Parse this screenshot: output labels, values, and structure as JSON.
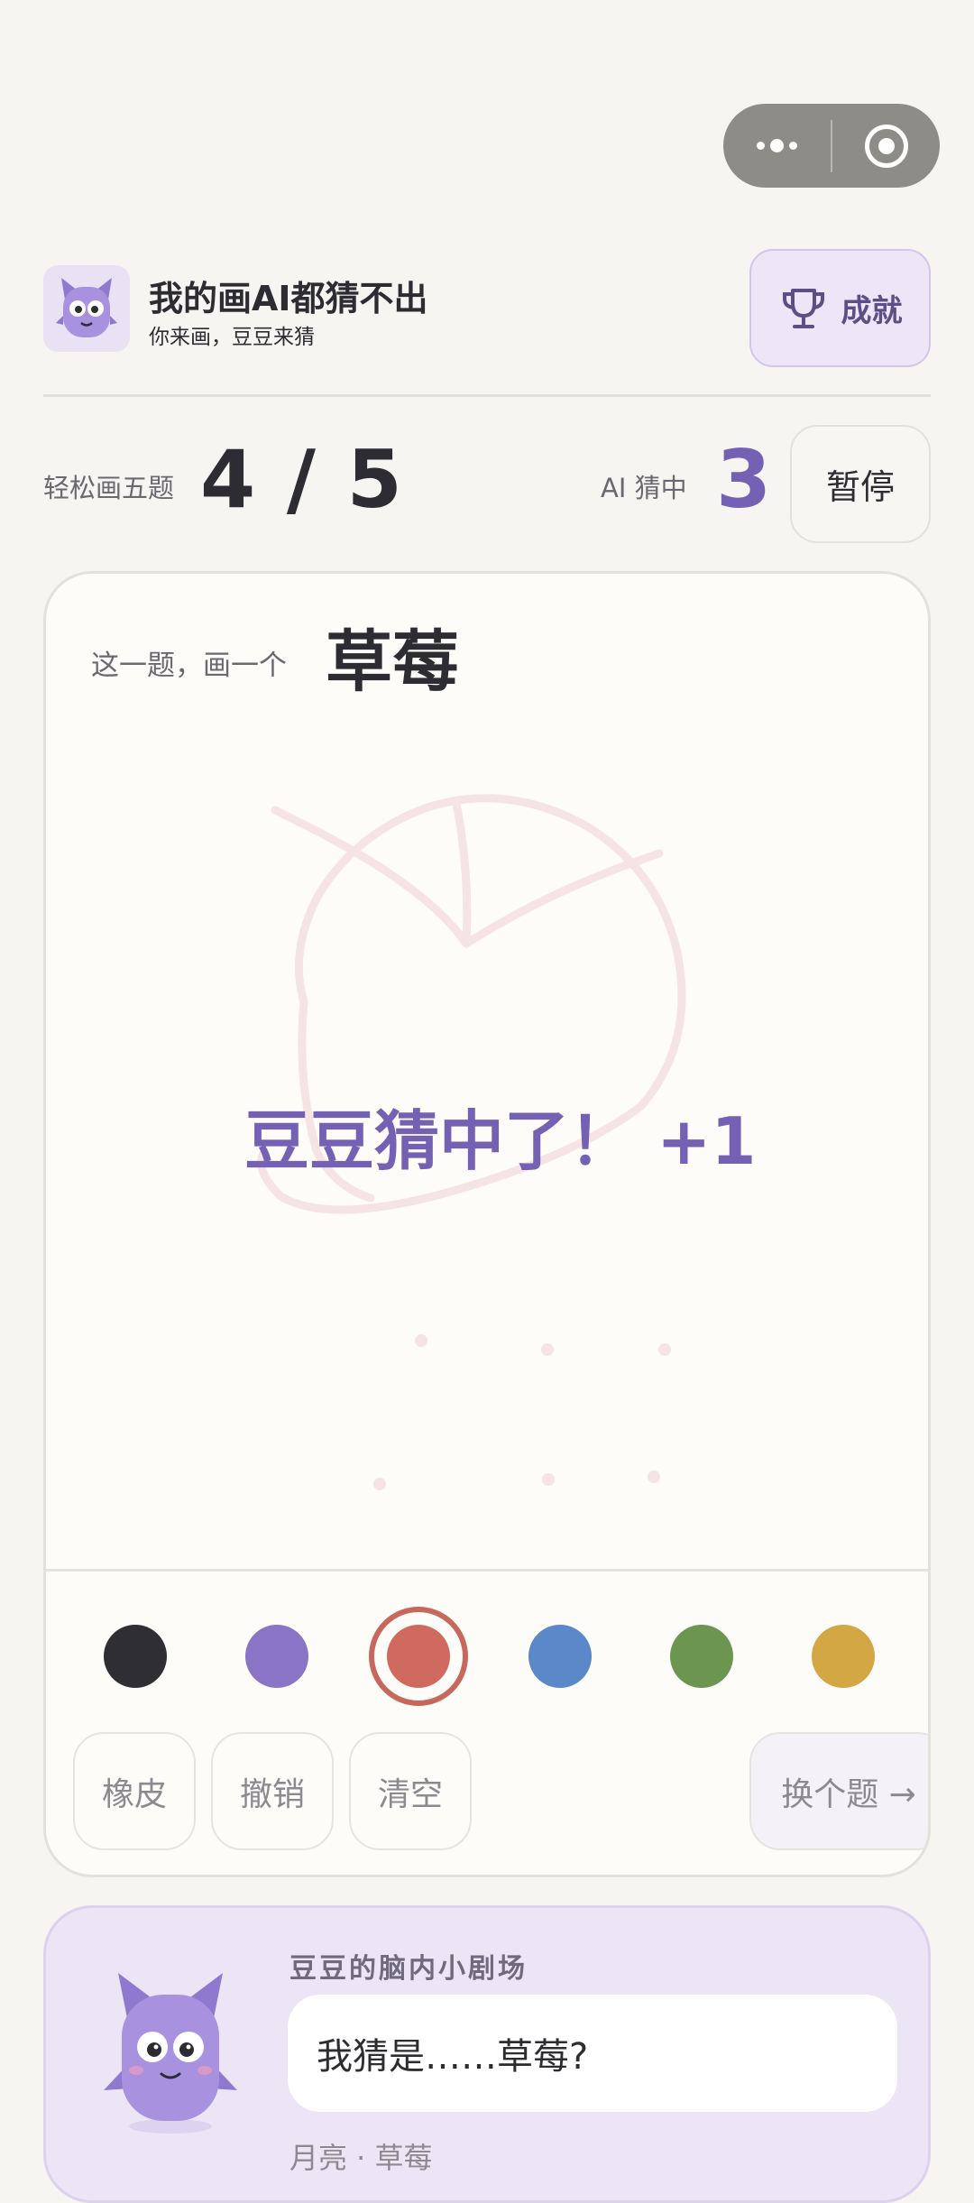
{
  "capsule": {
    "menu_icon": "more-dots-icon",
    "close_icon": "target-circle-icon"
  },
  "header": {
    "title": "我的画AI都猜不出",
    "subtitle": "你来画，豆豆来猜",
    "achievements_label": "成就",
    "achievements_icon": "trophy-icon",
    "avatar_icon": "purple-monster-icon"
  },
  "stats": {
    "mode_label": "轻松画五题",
    "progress": "4 / 5",
    "ai_guessed_label": "AI 猜中",
    "ai_guessed_count": "3",
    "pause_label": "暂停"
  },
  "canvas": {
    "prompt_label": "这一题，画一个",
    "prompt_word": "草莓",
    "result_text": "豆豆猜中了！  +1",
    "accent": "#7561b4"
  },
  "palette": {
    "colors": [
      "#2f2f33",
      "#8a74c6",
      "#d0695e",
      "#5a88c8",
      "#6c9550",
      "#d2a744"
    ],
    "selected": 2
  },
  "tools": {
    "eraser": "橡皮",
    "undo": "撤销",
    "clear": "清空",
    "next": "换个题 →"
  },
  "theater": {
    "title": "豆豆的脑内小剧场",
    "guess": "我猜是……草莓?",
    "history": "月亮 · 草莓"
  }
}
